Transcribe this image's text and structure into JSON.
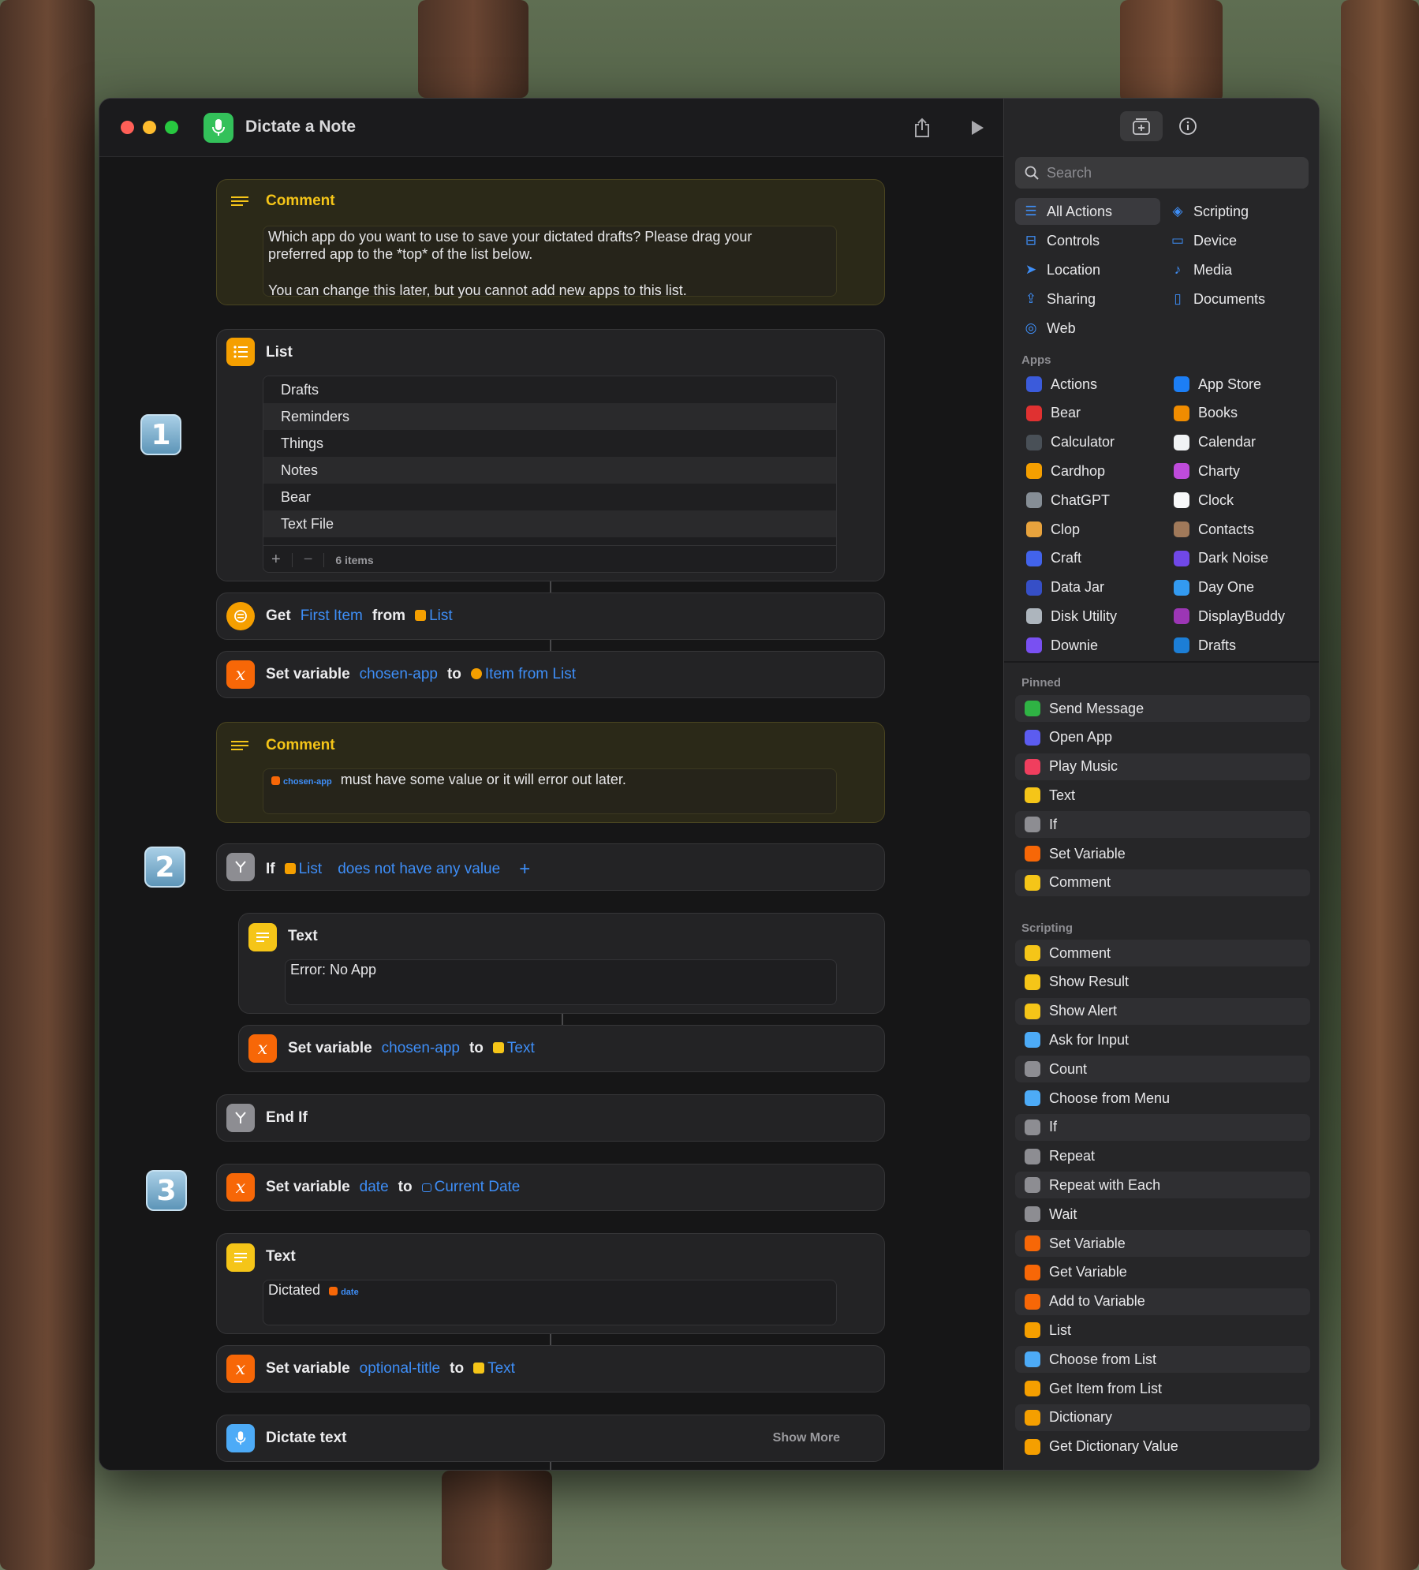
{
  "window": {
    "title": "Dictate a Note"
  },
  "comment1": {
    "title": "Comment",
    "line1": "Which app do you want to use to save your dictated drafts? Please drag your",
    "line2": "preferred app to the *top* of the list below.",
    "line3": "You can change this later, but you cannot add new apps to this list."
  },
  "list_action": {
    "title": "List",
    "items": [
      "Drafts",
      "Reminders",
      "Things",
      "Notes",
      "Bear",
      "Text File"
    ],
    "count": "6 items"
  },
  "get_item": {
    "verb": "Get",
    "param": "First Item",
    "from": "from",
    "source": "List"
  },
  "set_var1": {
    "verb": "Set variable",
    "name": "chosen-app",
    "to": "to",
    "value": "Item from List"
  },
  "comment2": {
    "title": "Comment",
    "token": "chosen-app",
    "text": "must have some value or it will error out later."
  },
  "if_action": {
    "verb": "If",
    "subject": "List",
    "condition": "does not have any value",
    "add": "+"
  },
  "text1": {
    "title": "Text",
    "value": "Error: No App"
  },
  "set_var2": {
    "verb": "Set variable",
    "name": "chosen-app",
    "to": "to",
    "value": "Text"
  },
  "end_if": {
    "title": "End If"
  },
  "set_var3": {
    "verb": "Set variable",
    "name": "date",
    "to": "to",
    "value": "Current Date"
  },
  "text2": {
    "title": "Text",
    "value": "Dictated",
    "token": "date"
  },
  "set_var4": {
    "verb": "Set variable",
    "name": "optional-title",
    "to": "to",
    "value": "Text"
  },
  "dictate": {
    "title": "Dictate text",
    "more": "Show More"
  },
  "badges": [
    "1",
    "2",
    "3"
  ],
  "sidebar": {
    "search_placeholder": "Search",
    "categories": [
      {
        "label": "All Actions",
        "icon": "list-icon"
      },
      {
        "label": "Scripting",
        "icon": "scripting-icon"
      },
      {
        "label": "Controls",
        "icon": "controls-icon"
      },
      {
        "label": "Device",
        "icon": "device-icon"
      },
      {
        "label": "Location",
        "icon": "location-icon"
      },
      {
        "label": "Media",
        "icon": "music-icon"
      },
      {
        "label": "Sharing",
        "icon": "share-icon"
      },
      {
        "label": "Documents",
        "icon": "document-icon"
      },
      {
        "label": "Web",
        "icon": "compass-icon"
      }
    ],
    "apps_label": "Apps",
    "apps": [
      {
        "label": "Actions",
        "color": "#3b5bdb"
      },
      {
        "label": "App Store",
        "color": "#1c7ef5"
      },
      {
        "label": "Bear",
        "color": "#e03131"
      },
      {
        "label": "Books",
        "color": "#f08c00"
      },
      {
        "label": "Calculator",
        "color": "#495057"
      },
      {
        "label": "Calendar",
        "color": "#f1f3f5"
      },
      {
        "label": "Cardhop",
        "color": "#f59f00"
      },
      {
        "label": "Charty",
        "color": "#be4bdb"
      },
      {
        "label": "ChatGPT",
        "color": "#868e96"
      },
      {
        "label": "Clock",
        "color": "#f8f9fa"
      },
      {
        "label": "Clop",
        "color": "#e8a33d"
      },
      {
        "label": "Contacts",
        "color": "#a0795a"
      },
      {
        "label": "Craft",
        "color": "#4263eb"
      },
      {
        "label": "Dark Noise",
        "color": "#7048e8"
      },
      {
        "label": "Data Jar",
        "color": "#364fc7"
      },
      {
        "label": "Day One",
        "color": "#339af0"
      },
      {
        "label": "Disk Utility",
        "color": "#adb5bd"
      },
      {
        "label": "DisplayBuddy",
        "color": "#9c36b5"
      },
      {
        "label": "Downie",
        "color": "#7950f2"
      },
      {
        "label": "Drafts",
        "color": "#1c7ed6"
      }
    ],
    "pinned_label": "Pinned",
    "pinned": [
      {
        "label": "Send Message",
        "color": "#2fb344"
      },
      {
        "label": "Open App",
        "color": "#5c5cf0"
      },
      {
        "label": "Play Music",
        "color": "#f03e5e"
      },
      {
        "label": "Text",
        "color": "#f5c518"
      },
      {
        "label": "If",
        "color": "#8d8d92"
      },
      {
        "label": "Set Variable",
        "color": "#f76707"
      },
      {
        "label": "Comment",
        "color": "#f5c518"
      }
    ],
    "scripting_label": "Scripting",
    "scripting": [
      {
        "label": "Comment",
        "color": "#f5c518"
      },
      {
        "label": "Show Result",
        "color": "#f5c518"
      },
      {
        "label": "Show Alert",
        "color": "#f5c518"
      },
      {
        "label": "Ask for Input",
        "color": "#4dabf7"
      },
      {
        "label": "Count",
        "color": "#8d8d92"
      },
      {
        "label": "Choose from Menu",
        "color": "#4dabf7"
      },
      {
        "label": "If",
        "color": "#8d8d92"
      },
      {
        "label": "Repeat",
        "color": "#8d8d92"
      },
      {
        "label": "Repeat with Each",
        "color": "#8d8d92"
      },
      {
        "label": "Wait",
        "color": "#8d8d92"
      },
      {
        "label": "Set Variable",
        "color": "#f76707"
      },
      {
        "label": "Get Variable",
        "color": "#f76707"
      },
      {
        "label": "Add to Variable",
        "color": "#f76707"
      },
      {
        "label": "List",
        "color": "#f59f00"
      },
      {
        "label": "Choose from List",
        "color": "#4dabf7"
      },
      {
        "label": "Get Item from List",
        "color": "#f59f00"
      },
      {
        "label": "Dictionary",
        "color": "#f59f00"
      },
      {
        "label": "Get Dictionary Value",
        "color": "#f59f00"
      }
    ]
  }
}
